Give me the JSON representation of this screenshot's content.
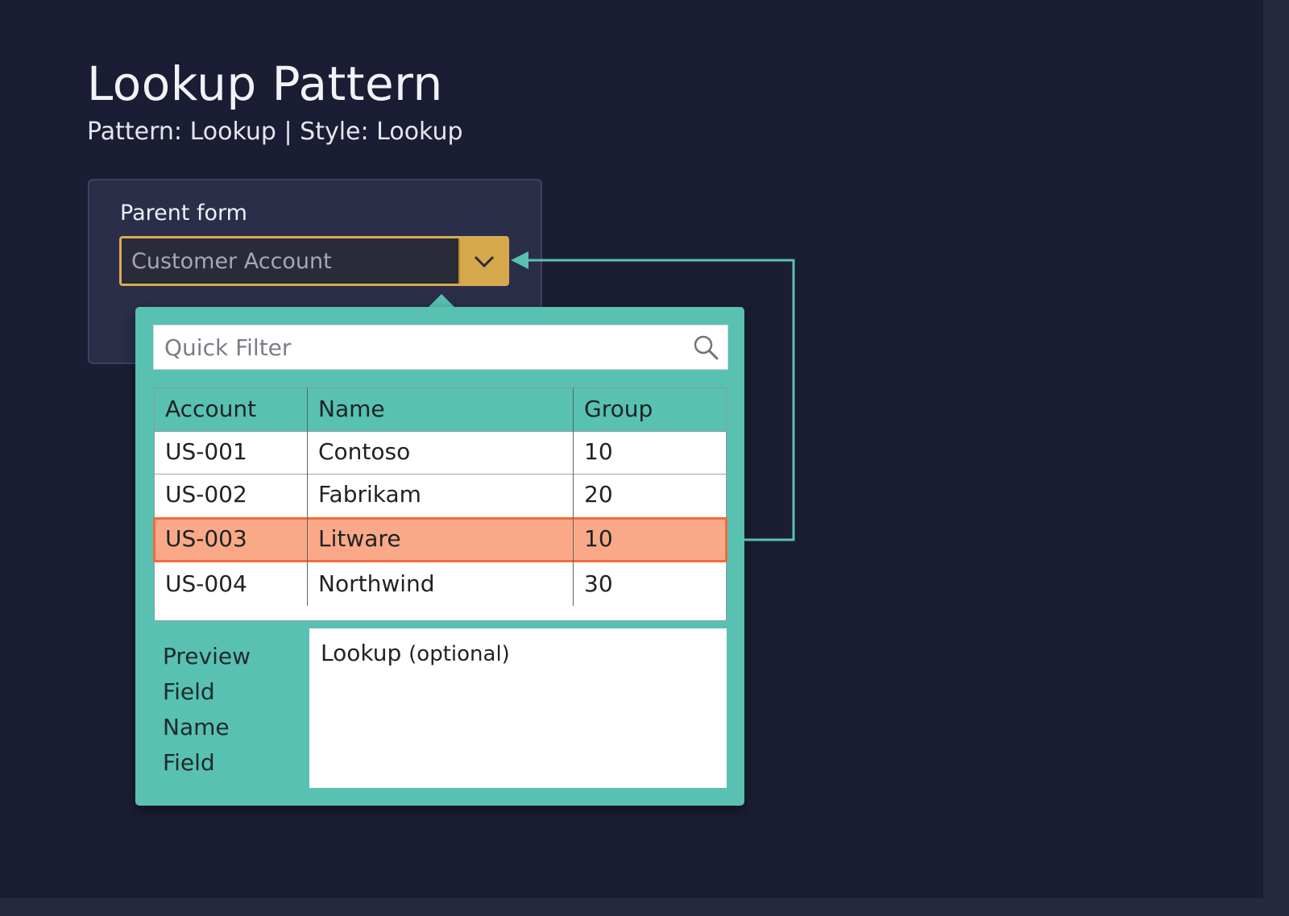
{
  "page": {
    "title": "Lookup Pattern",
    "subtitle": "Pattern: Lookup | Style: Lookup"
  },
  "parent_form": {
    "label": "Parent form",
    "combo_value": "Customer Account"
  },
  "lookup": {
    "filter_placeholder": "Quick Filter",
    "columns": [
      "Account",
      "Name",
      "Group"
    ],
    "rows": [
      {
        "account": "US-001",
        "name": "Contoso",
        "group": "10"
      },
      {
        "account": "US-002",
        "name": "Fabrikam",
        "group": "20"
      },
      {
        "account": "US-003",
        "name": "Litware",
        "group": "10"
      },
      {
        "account": "US-004",
        "name": "Northwind",
        "group": "30"
      }
    ],
    "selected_row_index": 2,
    "preview_labels": [
      "Preview",
      "Field",
      "Name",
      "Field"
    ],
    "preview_title": "Lookup",
    "preview_note": "(optional)"
  },
  "colors": {
    "background": "#1b1d34",
    "panel_teal": "#58c1b2",
    "combo_gold": "#d6a84c",
    "selected_row": "#f9a988",
    "selected_border": "#f06c3a",
    "connector": "#58c1b2"
  },
  "icons": {
    "dropdown": "chevron-down-icon",
    "filter": "search-icon"
  }
}
